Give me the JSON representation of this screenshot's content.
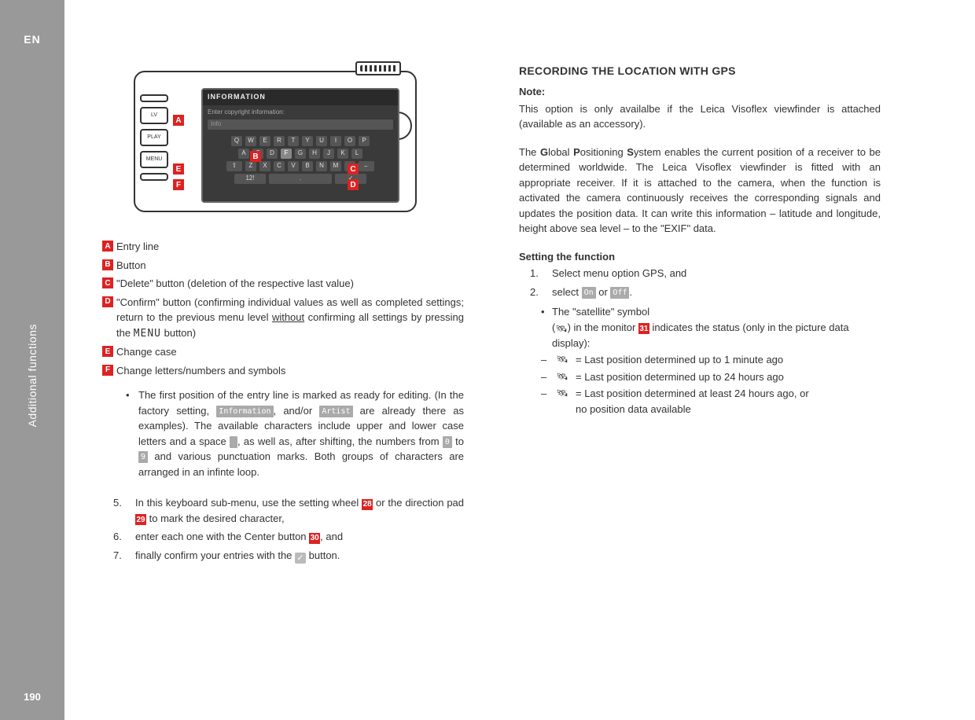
{
  "rail": {
    "lang": "EN",
    "section": "Additional functions",
    "page": "190"
  },
  "figure": {
    "lcd_title": "INFORMATION",
    "lcd_sub": "Enter copyright information:",
    "lcd_input": "Info",
    "row1": [
      "Q",
      "W",
      "E",
      "R",
      "T",
      "Y",
      "U",
      "I",
      "O",
      "P"
    ],
    "row2": [
      "A",
      "S",
      "D",
      "F",
      "G",
      "H",
      "J",
      "K",
      "L"
    ],
    "row3": [
      "⇧",
      "Z",
      "X",
      "C",
      "V",
      "B",
      "N",
      "M",
      "-",
      "←"
    ],
    "row4_left": "12!",
    "row4_space": ".",
    "row4_right": "✓",
    "side_buttons": [
      "",
      "LV",
      "PLAY",
      "MENU",
      ""
    ],
    "callouts": {
      "A": "A",
      "B": "B",
      "C": "C",
      "D": "D",
      "E": "E",
      "F": "F"
    }
  },
  "legend": {
    "A": "Entry line",
    "B": "Button",
    "C": "\"Delete\" button (deletion of the respective last value)",
    "D_pre": "\"Confirm\" button (confirming individual values as well as completed settings; return to the previous menu level ",
    "D_u": "without",
    "D_post_1": " confirming all settings by pressing the ",
    "D_mono": "MENU",
    "D_post_2": " button)",
    "E": "Change case",
    "F": "Change letters/numbers and symbols"
  },
  "bullet1_pre": "The first position of the entry line is marked as ready for editing. (In the factory setting, ",
  "chip_info": "Information",
  "bullet1_mid1": ", and/or ",
  "chip_artist": "Artist",
  "bullet1_mid2": " are already there as examples). The available characters include upper and lower case letters and a space ",
  "bullet1_mid3": ", as well as, after shifting, the numbers from ",
  "chip_0": "0",
  "bullet1_mid4": " to ",
  "chip_9": "9",
  "bullet1_post": " and various punctuation marks. Both groups of characters are arranged in an infinte loop.",
  "step5_pre": "In this keyboard sub-menu, use the setting wheel ",
  "ref28": "28",
  "step5_mid": " or the direction pad ",
  "ref29": "29",
  "step5_post": " to mark the desired character,",
  "step6_pre": "enter each one with the Center button ",
  "ref30": "30",
  "step6_post": ", and",
  "step7_pre": "finally confirm your entries with the ",
  "step7_post": " button.",
  "right": {
    "h2": "RECORDING THE LOCATION WITH GPS",
    "note_h": "Note:",
    "note_body": "This option is only availalbe if the Leica Visoflex viewfinder is attached (available as an accessory).",
    "gps_para_1": "The ",
    "g_G": "G",
    "g_lobal": "lobal ",
    "g_P": "P",
    "g_ositioning": "ositioning ",
    "g_S": "S",
    "g_ystem": "ystem enables the current position of a receiver to be determined worldwide. The Leica Visoflex viewfinder is fitted with an appropriate receiver. If it is attached to the camera, when the function is activated the camera continuously receives the corresponding signals and updates the position data. It can write this information – latitude and longitude, height above sea level – to the \"EXIF\" data.",
    "set_h": "Setting the function",
    "set_1": "Select menu option GPS, and",
    "set_2_pre": "select ",
    "on": "On",
    "set_2_mid": " or ",
    "off": "Off",
    "set_2_post": ".",
    "sb_pre": "The \"satellite\" symbol",
    "sb_line2_pre": "(",
    "sb_line2_mid": ") in the monitor ",
    "ref31": "31",
    "sb_line2_post": " indicates the status (only in the picture data display):",
    "sat1": "= Last position determined up to 1 minute ago",
    "sat2": "= Last position determined up to 24 hours ago",
    "sat3a": "= Last position determined at least 24 hours ago, or",
    "sat3b": "no position data available"
  }
}
